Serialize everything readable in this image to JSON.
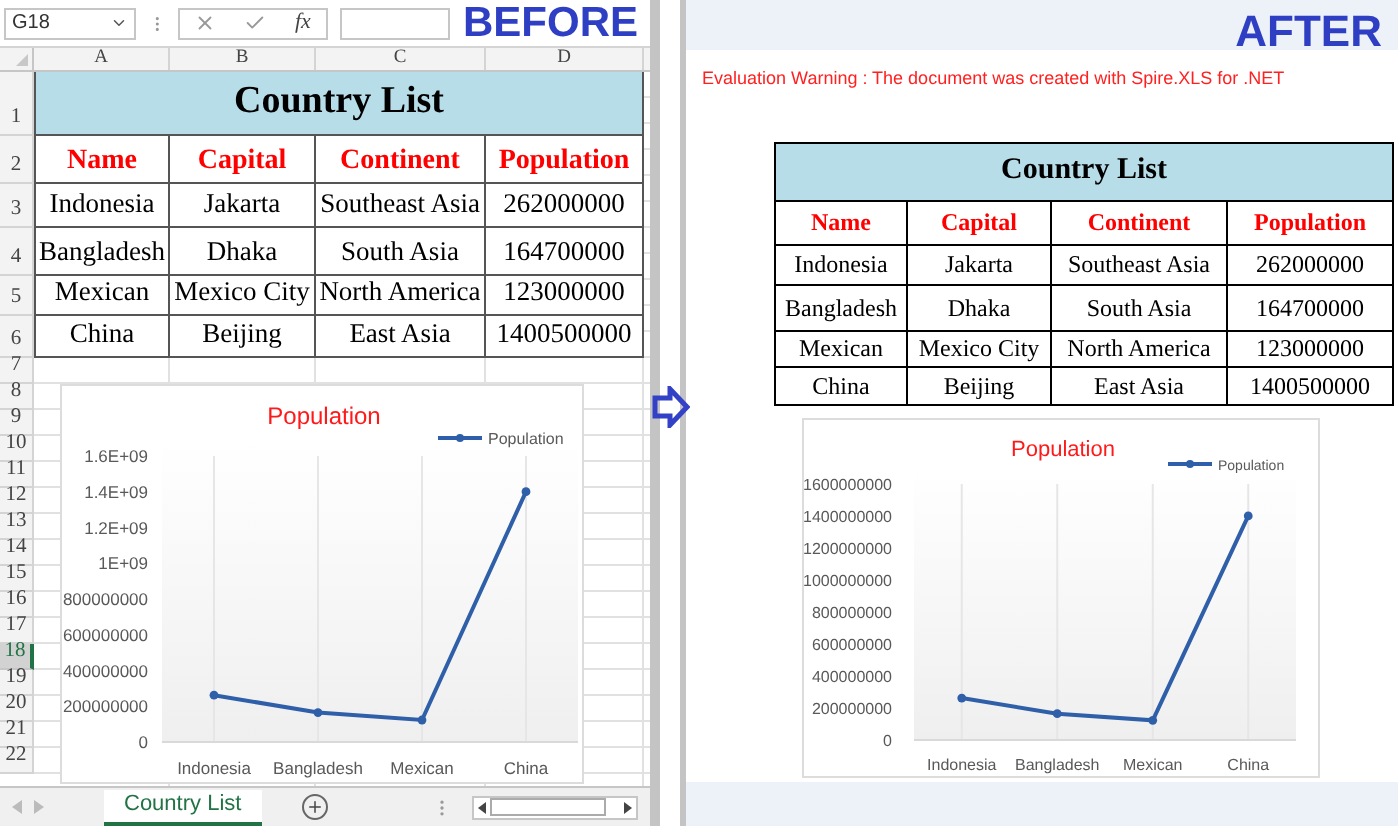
{
  "before": {
    "label": "BEFORE",
    "name_box": "G18",
    "formula_label": "fx",
    "column_headers": [
      "A",
      "B",
      "C",
      "D"
    ],
    "row_headers": [
      {
        "label": "1",
        "selected": false
      },
      {
        "label": "2",
        "selected": false
      },
      {
        "label": "3",
        "selected": false
      },
      {
        "label": "4",
        "selected": false
      },
      {
        "label": "5",
        "selected": false
      },
      {
        "label": "6",
        "selected": false
      },
      {
        "label": "7",
        "selected": false
      },
      {
        "label": "8",
        "selected": false
      },
      {
        "label": "9",
        "selected": false
      },
      {
        "label": "10",
        "selected": false
      },
      {
        "label": "11",
        "selected": false
      },
      {
        "label": "12",
        "selected": false
      },
      {
        "label": "13",
        "selected": false
      },
      {
        "label": "14",
        "selected": false
      },
      {
        "label": "15",
        "selected": false
      },
      {
        "label": "16",
        "selected": false
      },
      {
        "label": "17",
        "selected": false
      },
      {
        "label": "18",
        "selected": true
      },
      {
        "label": "19",
        "selected": false
      },
      {
        "label": "20",
        "selected": false
      },
      {
        "label": "21",
        "selected": false
      },
      {
        "label": "22",
        "selected": false
      }
    ],
    "table": {
      "title": "Country List",
      "columns": [
        "Name",
        "Capital",
        "Continent",
        "Population"
      ],
      "rows": [
        [
          "Indonesia",
          "Jakarta",
          "Southeast Asia",
          "262000000"
        ],
        [
          "Bangladesh",
          "Dhaka",
          "South Asia",
          "164700000"
        ],
        [
          "Mexican",
          "Mexico City",
          "North America",
          "123000000"
        ],
        [
          "China",
          "Beijing",
          "East Asia",
          "1400500000"
        ]
      ]
    },
    "chart_data": {
      "type": "line",
      "title": "Population",
      "categories": [
        "Indonesia",
        "Bangladesh",
        "Mexican",
        "China"
      ],
      "grid": true,
      "series": [
        {
          "name": "Population",
          "color": "#2e5fa8",
          "marker": true,
          "values": [
            262000000,
            164700000,
            123000000,
            1400500000
          ]
        }
      ],
      "ylim": [
        0,
        1600000000
      ],
      "yticks": [
        0,
        200000000,
        400000000,
        600000000,
        800000000,
        {
          "value": 1000000000,
          "label": "1E+09"
        },
        {
          "value": 1200000000,
          "label": "1.2E+09"
        },
        {
          "value": 1400000000,
          "label": "1.4E+09"
        },
        {
          "value": 1600000000,
          "label": "1.6E+09"
        }
      ]
    },
    "sheet_tabs": [
      {
        "label": "Country List",
        "selected": true
      }
    ]
  },
  "after": {
    "label": "AFTER",
    "warning": "Evaluation Warning : The document was created with  Spire.XLS for .NET",
    "table": {
      "title": "Country List",
      "columns": [
        "Name",
        "Capital",
        "Continent",
        "Population"
      ],
      "rows": [
        [
          "Indonesia",
          "Jakarta",
          "Southeast Asia",
          "262000000"
        ],
        [
          "Bangladesh",
          "Dhaka",
          "South Asia",
          "164700000"
        ],
        [
          "Mexican",
          "Mexico City",
          "North America",
          "123000000"
        ],
        [
          "China",
          "Beijing",
          "East Asia",
          "1400500000"
        ]
      ]
    },
    "chart_data": {
      "type": "line",
      "title": "Population",
      "categories": [
        "Indonesia",
        "Bangladesh",
        "Mexican",
        "China"
      ],
      "grid": true,
      "series": [
        {
          "name": "Population",
          "color": "#2e5fa8",
          "marker": true,
          "values": [
            262000000,
            164700000,
            123000000,
            1400500000
          ]
        }
      ],
      "ylim": [
        0,
        1600000000
      ],
      "yticks": [
        0,
        200000000,
        400000000,
        600000000,
        800000000,
        1000000000,
        1200000000,
        1400000000,
        1600000000
      ]
    }
  }
}
